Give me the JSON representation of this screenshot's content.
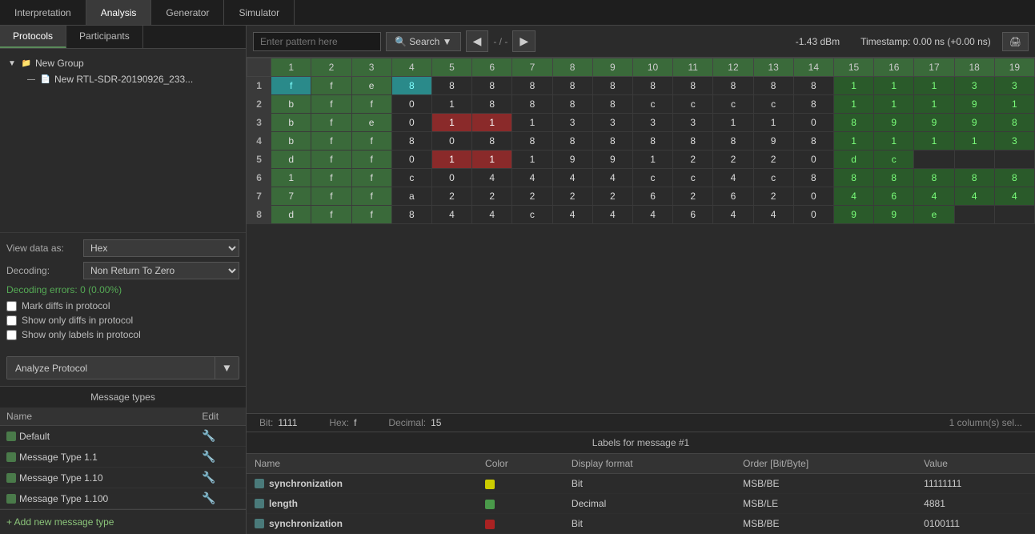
{
  "topTabs": [
    {
      "label": "Interpretation",
      "active": false
    },
    {
      "label": "Analysis",
      "active": true
    },
    {
      "label": "Generator",
      "active": false
    },
    {
      "label": "Simulator",
      "active": false
    }
  ],
  "leftPanel": {
    "tabs": [
      {
        "label": "Protocols",
        "active": true
      },
      {
        "label": "Participants",
        "active": false
      }
    ],
    "tree": {
      "group": "New Group",
      "file": "New RTL-SDR-20190926_233..."
    },
    "viewAs": {
      "label": "View data as:",
      "value": "Hex"
    },
    "decoding": {
      "label": "Decoding:",
      "value": "Non Return To Zero"
    },
    "decodingErrors": {
      "label": "Decoding errors:",
      "value": "0 (0.00%)"
    },
    "checkboxes": [
      {
        "label": "Mark diffs in protocol",
        "checked": false
      },
      {
        "label": "Show only diffs in protocol",
        "checked": false
      },
      {
        "label": "Show only labels in protocol",
        "checked": false
      }
    ],
    "analyzeBtn": "Analyze Protocol"
  },
  "toolbar": {
    "searchPlaceholder": "Enter pattern here",
    "searchLabel": "Search",
    "navSep": "- / -",
    "signal": "-1.43 dBm",
    "timestamp": "Timestamp:  0.00 ns (+0.00 ns)"
  },
  "grid": {
    "colHeaders": [
      "",
      "1",
      "2",
      "3",
      "4",
      "5",
      "6",
      "7",
      "8",
      "9",
      "10",
      "11",
      "12",
      "13",
      "14",
      "15",
      "16",
      "17",
      "18",
      "19"
    ],
    "rows": [
      {
        "rowNum": "1",
        "cells": [
          {
            "val": "f",
            "color": "teal"
          },
          {
            "val": "f",
            "color": "green-dark"
          },
          {
            "val": "e",
            "color": "green-dark"
          },
          {
            "val": "8",
            "color": "teal"
          },
          {
            "val": "8",
            "color": ""
          },
          {
            "val": "8",
            "color": ""
          },
          {
            "val": "8",
            "color": ""
          },
          {
            "val": "8",
            "color": ""
          },
          {
            "val": "8",
            "color": ""
          },
          {
            "val": "8",
            "color": ""
          },
          {
            "val": "8",
            "color": ""
          },
          {
            "val": "8",
            "color": ""
          },
          {
            "val": "8",
            "color": ""
          },
          {
            "val": "8",
            "color": ""
          },
          {
            "val": "1",
            "color": "highlight-green"
          },
          {
            "val": "1",
            "color": "highlight-green"
          },
          {
            "val": "1",
            "color": "highlight-green"
          },
          {
            "val": "3",
            "color": "highlight-green"
          },
          {
            "val": "3",
            "color": "highlight-green"
          }
        ]
      },
      {
        "rowNum": "2",
        "cells": [
          {
            "val": "b",
            "color": "green-dark"
          },
          {
            "val": "f",
            "color": "green-dark"
          },
          {
            "val": "f",
            "color": "green-dark"
          },
          {
            "val": "0",
            "color": ""
          },
          {
            "val": "1",
            "color": ""
          },
          {
            "val": "8",
            "color": ""
          },
          {
            "val": "8",
            "color": ""
          },
          {
            "val": "8",
            "color": ""
          },
          {
            "val": "8",
            "color": ""
          },
          {
            "val": "c",
            "color": ""
          },
          {
            "val": "c",
            "color": ""
          },
          {
            "val": "c",
            "color": ""
          },
          {
            "val": "c",
            "color": ""
          },
          {
            "val": "8",
            "color": ""
          },
          {
            "val": "1",
            "color": "highlight-green"
          },
          {
            "val": "1",
            "color": "highlight-green"
          },
          {
            "val": "1",
            "color": "highlight-green"
          },
          {
            "val": "9",
            "color": "highlight-green"
          },
          {
            "val": "1",
            "color": "highlight-green"
          }
        ]
      },
      {
        "rowNum": "3",
        "cells": [
          {
            "val": "b",
            "color": "green-dark"
          },
          {
            "val": "f",
            "color": "green-dark"
          },
          {
            "val": "e",
            "color": "green-dark"
          },
          {
            "val": "0",
            "color": ""
          },
          {
            "val": "1",
            "color": "red"
          },
          {
            "val": "1",
            "color": "red"
          },
          {
            "val": "1",
            "color": ""
          },
          {
            "val": "3",
            "color": ""
          },
          {
            "val": "3",
            "color": ""
          },
          {
            "val": "3",
            "color": ""
          },
          {
            "val": "3",
            "color": ""
          },
          {
            "val": "1",
            "color": ""
          },
          {
            "val": "1",
            "color": ""
          },
          {
            "val": "0",
            "color": ""
          },
          {
            "val": "8",
            "color": "highlight-green"
          },
          {
            "val": "9",
            "color": "highlight-green"
          },
          {
            "val": "9",
            "color": "highlight-green"
          },
          {
            "val": "9",
            "color": "highlight-green"
          },
          {
            "val": "8",
            "color": "highlight-green"
          }
        ]
      },
      {
        "rowNum": "4",
        "cells": [
          {
            "val": "b",
            "color": "green-dark"
          },
          {
            "val": "f",
            "color": "green-dark"
          },
          {
            "val": "f",
            "color": "green-dark"
          },
          {
            "val": "8",
            "color": ""
          },
          {
            "val": "0",
            "color": ""
          },
          {
            "val": "8",
            "color": ""
          },
          {
            "val": "8",
            "color": ""
          },
          {
            "val": "8",
            "color": ""
          },
          {
            "val": "8",
            "color": ""
          },
          {
            "val": "8",
            "color": ""
          },
          {
            "val": "8",
            "color": ""
          },
          {
            "val": "8",
            "color": ""
          },
          {
            "val": "9",
            "color": ""
          },
          {
            "val": "8",
            "color": ""
          },
          {
            "val": "1",
            "color": "highlight-green"
          },
          {
            "val": "1",
            "color": "highlight-green"
          },
          {
            "val": "1",
            "color": "highlight-green"
          },
          {
            "val": "1",
            "color": "highlight-green"
          },
          {
            "val": "3",
            "color": "highlight-green"
          }
        ]
      },
      {
        "rowNum": "5",
        "cells": [
          {
            "val": "d",
            "color": "green-dark"
          },
          {
            "val": "f",
            "color": "green-dark"
          },
          {
            "val": "f",
            "color": "green-dark"
          },
          {
            "val": "0",
            "color": ""
          },
          {
            "val": "1",
            "color": "red"
          },
          {
            "val": "1",
            "color": "red"
          },
          {
            "val": "1",
            "color": ""
          },
          {
            "val": "9",
            "color": ""
          },
          {
            "val": "9",
            "color": ""
          },
          {
            "val": "1",
            "color": ""
          },
          {
            "val": "2",
            "color": ""
          },
          {
            "val": "2",
            "color": ""
          },
          {
            "val": "2",
            "color": ""
          },
          {
            "val": "0",
            "color": ""
          },
          {
            "val": "d",
            "color": "highlight-green"
          },
          {
            "val": "c",
            "color": "highlight-green"
          },
          {
            "val": "",
            "color": ""
          },
          {
            "val": "",
            "color": ""
          },
          {
            "val": "",
            "color": ""
          }
        ]
      },
      {
        "rowNum": "6",
        "cells": [
          {
            "val": "1",
            "color": "green-dark"
          },
          {
            "val": "f",
            "color": "green-dark"
          },
          {
            "val": "f",
            "color": "green-dark"
          },
          {
            "val": "c",
            "color": ""
          },
          {
            "val": "0",
            "color": ""
          },
          {
            "val": "4",
            "color": ""
          },
          {
            "val": "4",
            "color": ""
          },
          {
            "val": "4",
            "color": ""
          },
          {
            "val": "4",
            "color": ""
          },
          {
            "val": "c",
            "color": ""
          },
          {
            "val": "c",
            "color": ""
          },
          {
            "val": "4",
            "color": ""
          },
          {
            "val": "c",
            "color": ""
          },
          {
            "val": "8",
            "color": ""
          },
          {
            "val": "8",
            "color": "highlight-green"
          },
          {
            "val": "8",
            "color": "highlight-green"
          },
          {
            "val": "8",
            "color": "highlight-green"
          },
          {
            "val": "8",
            "color": "highlight-green"
          },
          {
            "val": "8",
            "color": "highlight-green"
          }
        ]
      },
      {
        "rowNum": "7",
        "cells": [
          {
            "val": "7",
            "color": "green-dark"
          },
          {
            "val": "f",
            "color": "green-dark"
          },
          {
            "val": "f",
            "color": "green-dark"
          },
          {
            "val": "a",
            "color": ""
          },
          {
            "val": "2",
            "color": ""
          },
          {
            "val": "2",
            "color": ""
          },
          {
            "val": "2",
            "color": ""
          },
          {
            "val": "2",
            "color": ""
          },
          {
            "val": "2",
            "color": ""
          },
          {
            "val": "6",
            "color": ""
          },
          {
            "val": "2",
            "color": ""
          },
          {
            "val": "6",
            "color": ""
          },
          {
            "val": "2",
            "color": ""
          },
          {
            "val": "0",
            "color": ""
          },
          {
            "val": "4",
            "color": "highlight-green"
          },
          {
            "val": "6",
            "color": "highlight-green"
          },
          {
            "val": "4",
            "color": "highlight-green"
          },
          {
            "val": "4",
            "color": "highlight-green"
          },
          {
            "val": "4",
            "color": "highlight-green"
          }
        ]
      },
      {
        "rowNum": "8",
        "cells": [
          {
            "val": "d",
            "color": "green-dark"
          },
          {
            "val": "f",
            "color": "green-dark"
          },
          {
            "val": "f",
            "color": "green-dark"
          },
          {
            "val": "8",
            "color": ""
          },
          {
            "val": "4",
            "color": ""
          },
          {
            "val": "4",
            "color": ""
          },
          {
            "val": "c",
            "color": ""
          },
          {
            "val": "4",
            "color": ""
          },
          {
            "val": "4",
            "color": ""
          },
          {
            "val": "4",
            "color": ""
          },
          {
            "val": "6",
            "color": ""
          },
          {
            "val": "4",
            "color": ""
          },
          {
            "val": "4",
            "color": ""
          },
          {
            "val": "0",
            "color": ""
          },
          {
            "val": "9",
            "color": "highlight-green"
          },
          {
            "val": "9",
            "color": "highlight-green"
          },
          {
            "val": "e",
            "color": "highlight-green"
          },
          {
            "val": "",
            "color": ""
          },
          {
            "val": "",
            "color": ""
          }
        ]
      }
    ]
  },
  "statusBar": {
    "bit": "1111",
    "hex": "f",
    "decimal": "15",
    "columnsSelected": "1  column(s) sel..."
  },
  "bottomPanel": {
    "msgTypesHeader": "Message types",
    "labelsHeader": "Labels for message #1",
    "msgTypesColName": "Name",
    "msgTypesColEdit": "Edit",
    "msgTypes": [
      {
        "name": "Default",
        "color": "#4a7a4a"
      },
      {
        "name": "Message Type 1.1",
        "color": "#4a7a4a"
      },
      {
        "name": "Message Type 1.10",
        "color": "#4a7a4a"
      },
      {
        "name": "Message Type 1.100",
        "color": "#4a7a4a"
      }
    ],
    "addMsgBtn": "+ Add new message type",
    "labelsColumns": [
      "Name",
      "Color",
      "Display format",
      "Order [Bit/Byte]",
      "Value"
    ],
    "labels": [
      {
        "name": "synchronization",
        "color": "#cccc00",
        "format": "Bit",
        "order": "MSB/BE",
        "value": "11111111"
      },
      {
        "name": "length",
        "color": "#4a9a4a",
        "format": "Decimal",
        "order": "MSB/LE",
        "value": "4881"
      },
      {
        "name": "synchronization",
        "color": "#aa2222",
        "format": "Bit",
        "order": "MSB/BE",
        "value": "0100111"
      }
    ]
  }
}
